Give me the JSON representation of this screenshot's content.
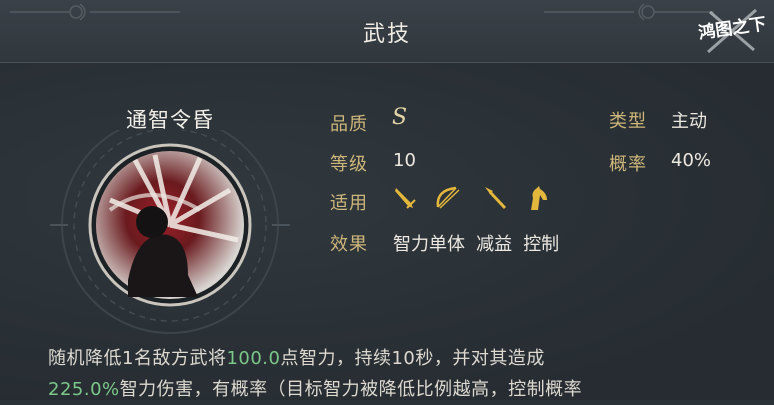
{
  "header": {
    "title": "武技",
    "logo_text": "鸿图之下"
  },
  "skill": {
    "name": "通智令昏",
    "quality_label": "品质",
    "quality_value": "S",
    "type_label": "类型",
    "type_value": "主动",
    "level_label": "等级",
    "level_value": "10",
    "chance_label": "概率",
    "chance_value": "40%",
    "applicable_label": "适用",
    "applicable_icons": [
      "sword-icon",
      "bow-icon",
      "spear-icon",
      "horse-icon"
    ],
    "effect_label": "效果",
    "effects": [
      "智力单体",
      "减益",
      "控制"
    ]
  },
  "description": {
    "line1_a": "随机降低1名敌方武将",
    "line1_hl": "100.0",
    "line1_b": "点智力，持续10秒，并对其造成",
    "line2_hl": "225.0%",
    "line2_b": "智力伤害，有概率（目标智力被降低比例越高，控制概率"
  },
  "colors": {
    "label_gold": "#cdb67a",
    "highlight_green": "#7cc78a",
    "background": "#2b3238"
  }
}
